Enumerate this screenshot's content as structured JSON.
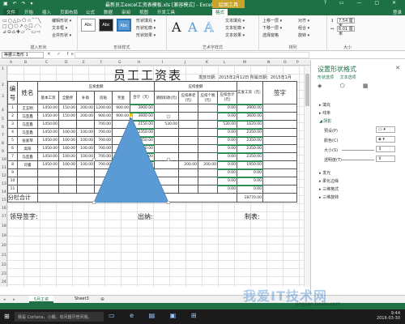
{
  "window": {
    "quick_access": "▣ ↶ ↷ ▾",
    "title": "最新员工excel工资表模板.xls [兼容模式] - Excel",
    "context_tab": "绘图工具",
    "controls": "? ▭ — ▢ ✕"
  },
  "tabs": [
    "文件",
    "开始",
    "插入",
    "页面布局",
    "公式",
    "数据",
    "审阅",
    "视图",
    "开发工具",
    "格式"
  ],
  "active_tab": "格式",
  "user": "登录",
  "ribbon": {
    "insert_shapes": {
      "grid": "▭○△▷⬠☆⌒╲\n▢◯⬡↗◇☐⟋⟍\n⊿⊖⌂✚▱⌒▭⇨",
      "edit_shape": "编辑形状 ▾",
      "text_box": "文本框 ▾",
      "merge": "合并形状 ▾",
      "label": "插入形状"
    },
    "shape_styles": {
      "swatches": [
        "Abc",
        "Abc",
        "Abc"
      ],
      "fill": "形状填充 ▾",
      "outline": "形状轮廓 ▾",
      "effects": "形状效果 ▾",
      "label": "形状样式"
    },
    "wordart": {
      "letters": [
        "A",
        "A",
        "A"
      ],
      "text_fill": "文本填充 ▾",
      "text_outline": "文本轮廓 ▾",
      "text_effects": "文本效果 ▾",
      "label": "艺术字样式"
    },
    "arrange": {
      "bring_forward": "上移一层 ▾",
      "send_backward": "下移一层 ▾",
      "selection_pane": "选择窗格",
      "align": "对齐 ▾",
      "group": "组合 ▾",
      "rotate": "旋转 ▾",
      "label": "排列"
    },
    "size": {
      "height": "7.54 厘米",
      "width": "6.01 厘米",
      "label": "大小"
    }
  },
  "formula_bar": {
    "name_box": "等腰三角形 1",
    "fx": "✕ ✓ fx",
    "formula": ""
  },
  "columns": [
    "A",
    "B",
    "C",
    "D",
    "E",
    "F",
    "G",
    "H",
    "I",
    "J",
    "K",
    "L",
    "M",
    "N",
    "O",
    "P"
  ],
  "rows": [
    "1",
    "2",
    "3",
    "4",
    "5",
    "6",
    "7",
    "8",
    "9",
    "10",
    "11",
    "12",
    "13",
    "14",
    "15",
    "16",
    "17",
    "18",
    "19",
    "20",
    "21",
    "22",
    "23",
    "24"
  ],
  "sheet": {
    "title": "员工工资表",
    "issue_date": "发放日期：2015年2月12日 所属日期：2015年1月",
    "headers": {
      "no": "编号",
      "name": "姓名",
      "payable": "应发金额",
      "deduct": "应扣金额",
      "actual": "实发工资（元）",
      "sign": "签字",
      "base": "基本工资",
      "post": "全勤奖",
      "subsidy": "补助",
      "housing": "房贴",
      "bonus": "奖金",
      "total": "合计（元）",
      "leave": "请假扣款(元)",
      "pension": "应扣养老(元)",
      "tax": "应扣个税(元)",
      "deduct_total": "应扣合计(元)"
    },
    "rows": [
      [
        "1",
        "王五明",
        "1450.00",
        "150.00",
        "200.00",
        "1200.00",
        "900.00",
        "3900.00",
        "",
        "",
        "",
        "0.00",
        "3900.00",
        ""
      ],
      [
        "2",
        "马亚鑫",
        "1450.00",
        "150.00",
        "200.00",
        "900.00",
        "900.00",
        "3600.00",
        "",
        "",
        "",
        "0.00",
        "3600.00",
        ""
      ],
      [
        "3",
        "马亚鑫",
        "1450.00",
        "",
        "",
        "700.00",
        "",
        "2150.00",
        "530.00",
        "",
        "",
        "530.00",
        "1620.00",
        ""
      ],
      [
        "4",
        "马亚鑫",
        "1450.00",
        "100.00",
        "100.00",
        "700.00",
        "",
        "2350.00",
        "",
        "",
        "",
        "0.00",
        "2350.00",
        ""
      ],
      [
        "5",
        "张爱琴",
        "1450.00",
        "100.00",
        "100.00",
        "700.00",
        "",
        "2350.00",
        "",
        "",
        "",
        "0.00",
        "2350.00",
        ""
      ],
      [
        "6",
        "高阳",
        "1450.00",
        "100.00",
        "100.00",
        "700.00",
        "",
        "2350.00",
        "",
        "",
        "",
        "0.00",
        "2350.00",
        ""
      ],
      [
        "7",
        "马亚鑫",
        "1450.00",
        "100.00",
        "100.00",
        "700.00",
        "",
        "2350.00",
        "",
        "",
        "",
        "0.00",
        "2350.00",
        ""
      ],
      [
        "8",
        "司睿",
        "1450.00",
        "100.00",
        "100.00",
        "700.00",
        "",
        "2350.00",
        "",
        "200.00",
        "200.00",
        "0.00",
        "1950.00",
        ""
      ],
      [
        "9",
        "",
        "",
        "",
        "",
        "",
        "",
        "",
        "",
        "",
        "",
        "0.00",
        "0.00",
        ""
      ],
      [
        "10",
        "",
        "",
        "",
        "",
        "",
        "",
        "",
        "",
        "",
        "",
        "0.00",
        "0.00",
        ""
      ],
      [
        "11",
        "",
        "",
        "",
        "",
        "",
        "",
        "",
        "",
        "",
        "",
        "0.00",
        "0.00",
        ""
      ]
    ],
    "subtotal_label": "分栏合计",
    "subtotal_value": "18770.00",
    "leader_sign": "领导签字:",
    "cashier": "出纳:",
    "preparer": "制表:"
  },
  "format_pane": {
    "title": "设置形状格式",
    "close": "✕",
    "tabs": [
      "形状选项",
      "文本选项"
    ],
    "icons": "◈ ⬠ ▦",
    "sections": {
      "fill": "▸ 填充",
      "line": "▸ 线条",
      "shadow": "◢ 阴影",
      "glow": "▸ 发光",
      "soft_edges": "▸ 柔化边缘",
      "three_d_format": "▸ 三维格式",
      "three_d_rotation": "▸ 三维旋转"
    },
    "fields": {
      "preset": "预设(P)",
      "color": "颜色(C)",
      "size": "大小(S)",
      "transparency": "透明度(T)"
    }
  },
  "sheet_tabs": {
    "nav": "◂ ▸",
    "tabs": [
      "5月工资",
      "Sheet3"
    ],
    "active": "5月工资",
    "add": "⊕"
  },
  "taskbar": {
    "start": "⊞",
    "search": "我是 Cortana，小娜。有问题尽管问我。",
    "apps": "▭ e ▤ ▣ ⊞",
    "time": "9:44",
    "date": "2016-03-30"
  },
  "watermark": "我爱IT技术网",
  "watermark_url": "jingyan.baidu.com",
  "colors": {
    "excel_green": "#1e7145",
    "shape_fill": "#5b9bd5",
    "context_tab": "#c8a52a"
  }
}
